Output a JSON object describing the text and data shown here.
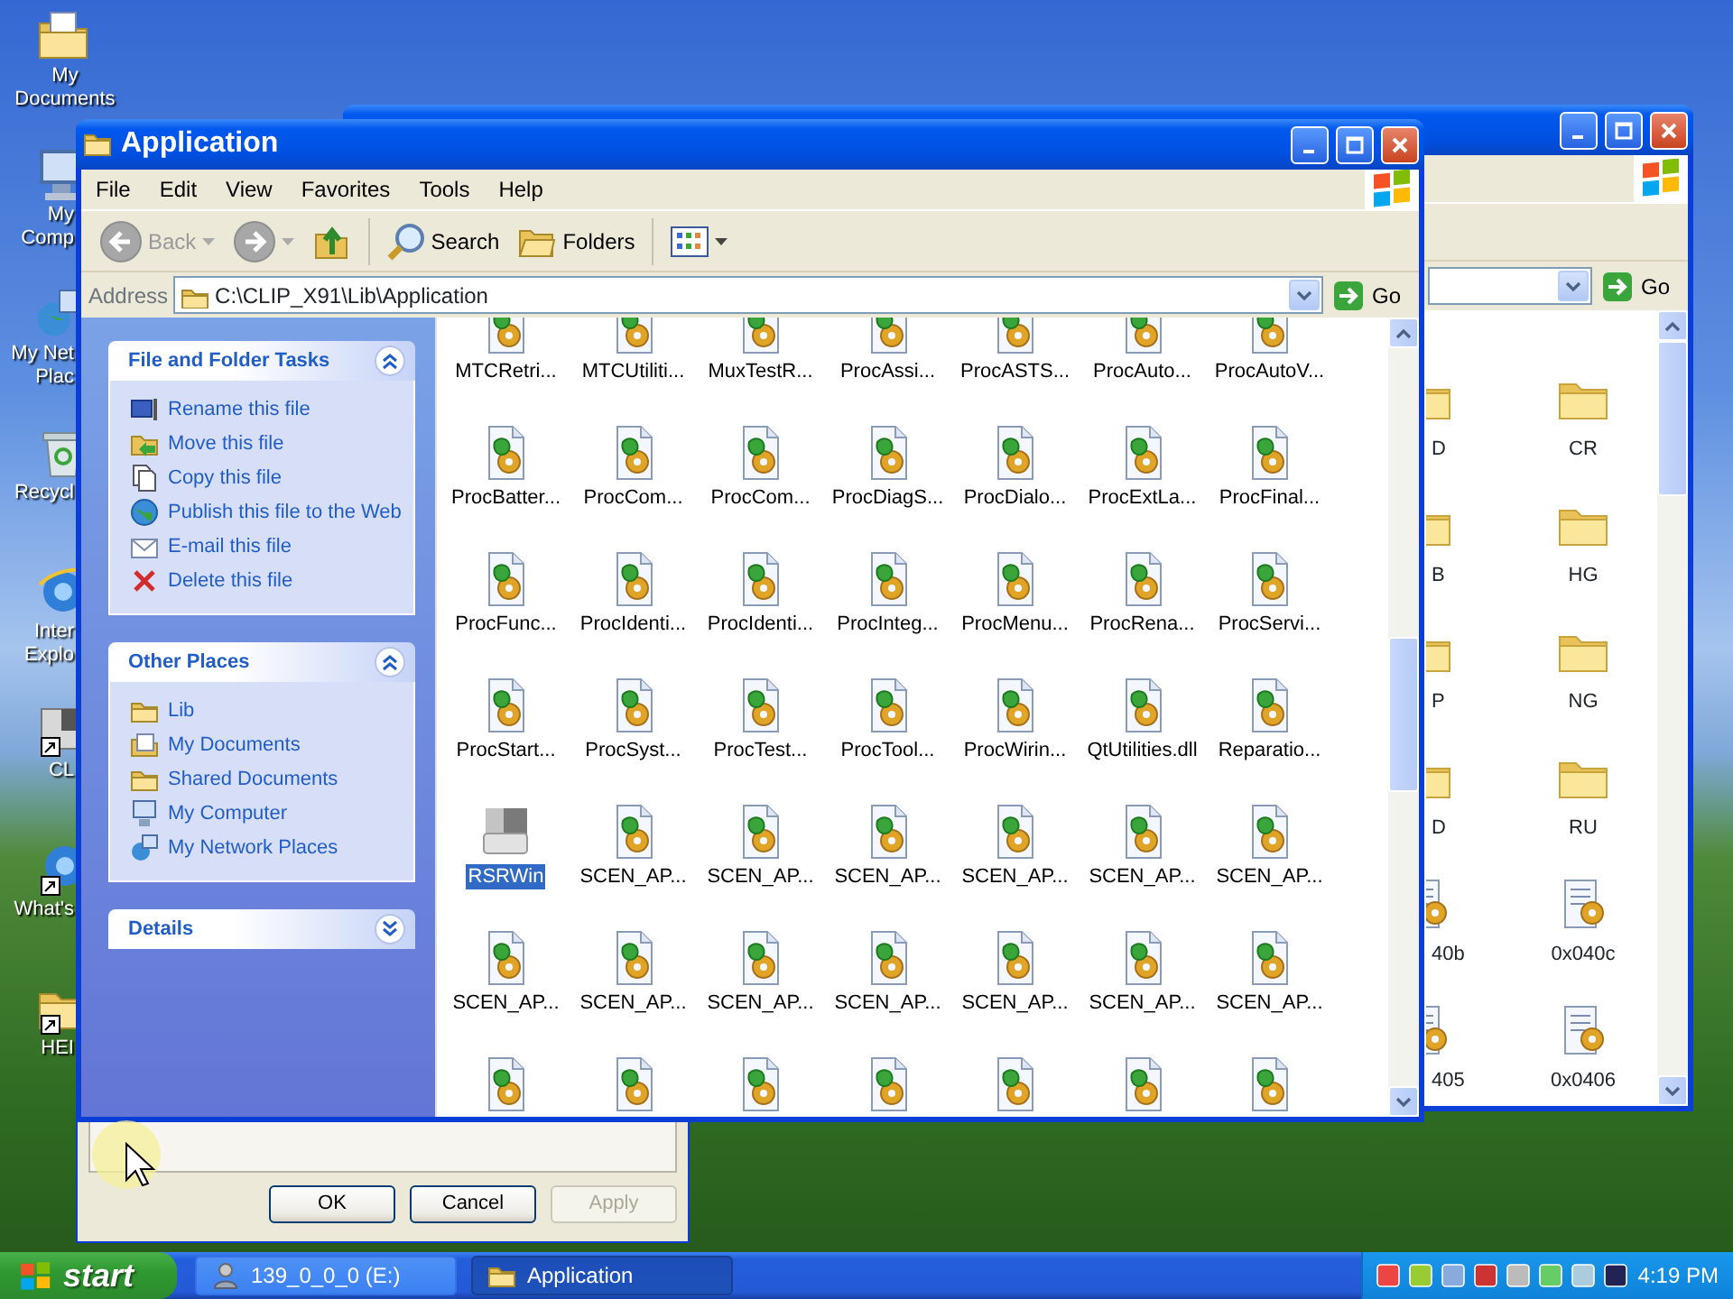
{
  "desktop": {
    "icons": [
      {
        "kind": "documents",
        "label": "My Documents"
      },
      {
        "kind": "computer",
        "label": "My Comp"
      },
      {
        "kind": "network",
        "label": "My Net Plac"
      },
      {
        "kind": "recycle",
        "label": "Recycl"
      },
      {
        "kind": "browser",
        "label": "Inter Explo"
      },
      {
        "kind": "app-shortcut",
        "label": "CL"
      },
      {
        "kind": "browser-shortcut",
        "label": "What's"
      },
      {
        "kind": "folder-shortcut",
        "label": "HEI"
      }
    ]
  },
  "back_window": {
    "go": "Go",
    "rows": [
      {
        "cells": [
          {
            "kind": "folder",
            "label": "D"
          },
          {
            "kind": "folder",
            "label": "CR"
          }
        ]
      },
      {
        "cells": [
          {
            "kind": "folder",
            "label": "B"
          },
          {
            "kind": "folder",
            "label": "HG"
          }
        ]
      },
      {
        "cells": [
          {
            "kind": "folder",
            "label": "P"
          },
          {
            "kind": "folder",
            "label": "NG"
          }
        ]
      },
      {
        "cells": [
          {
            "kind": "folder",
            "label": "D"
          },
          {
            "kind": "folder",
            "label": "RU"
          }
        ]
      },
      {
        "cells": [
          {
            "kind": "note",
            "label": "40b"
          },
          {
            "kind": "note",
            "label": "0x040c"
          }
        ]
      },
      {
        "cells": [
          {
            "kind": "note",
            "label": "405"
          },
          {
            "kind": "note",
            "label": "0x0406"
          }
        ]
      }
    ]
  },
  "dialog": {
    "buttons": [
      {
        "label": "OK",
        "disabled": false
      },
      {
        "label": "Cancel",
        "disabled": false
      },
      {
        "label": "Apply",
        "disabled": true
      }
    ]
  },
  "window": {
    "title": "Application",
    "menu": [
      "File",
      "Edit",
      "View",
      "Favorites",
      "Tools",
      "Help"
    ],
    "toolbar": [
      {
        "kind": "back",
        "label": "Back",
        "disabled": true
      },
      {
        "kind": "forward",
        "disabled": true
      },
      {
        "kind": "up",
        "disabled": false
      },
      {
        "kind": "search",
        "label": "Search"
      },
      {
        "kind": "folders",
        "label": "Folders"
      },
      {
        "kind": "views"
      }
    ],
    "address": {
      "label": "Address",
      "value": "C:\\CLIP_X91\\Lib\\Application",
      "go": "Go"
    },
    "task_panels": [
      {
        "title": "File and Folder Tasks",
        "expanded": true,
        "items": [
          {
            "kind": "rename",
            "label": "Rename this file"
          },
          {
            "kind": "move",
            "label": "Move this file"
          },
          {
            "kind": "copy",
            "label": "Copy this file"
          },
          {
            "kind": "publish",
            "label": "Publish this file to the Web"
          },
          {
            "kind": "email",
            "label": "E-mail this file"
          },
          {
            "kind": "delete",
            "label": "Delete this file"
          }
        ]
      },
      {
        "title": "Other Places",
        "expanded": true,
        "items": [
          {
            "kind": "folder",
            "label": "Lib"
          },
          {
            "kind": "documents",
            "label": "My Documents"
          },
          {
            "kind": "folder",
            "label": "Shared Documents"
          },
          {
            "kind": "computer",
            "label": "My Computer"
          },
          {
            "kind": "network",
            "label": "My Network Places"
          }
        ]
      },
      {
        "title": "Details",
        "expanded": false
      }
    ],
    "files": [
      {
        "kind": "script",
        "label": "MTCRetri...",
        "selected": false
      },
      {
        "kind": "script",
        "label": "MTCUtiliti...",
        "selected": false
      },
      {
        "kind": "script",
        "label": "MuxTestR...",
        "selected": false
      },
      {
        "kind": "script",
        "label": "ProcAssi...",
        "selected": false
      },
      {
        "kind": "script",
        "label": "ProcASTS...",
        "selected": false
      },
      {
        "kind": "script",
        "label": "ProcAuto...",
        "selected": false
      },
      {
        "kind": "script",
        "label": "ProcAutoV...",
        "selected": false
      },
      {
        "kind": "script",
        "label": "ProcBatter...",
        "selected": false
      },
      {
        "kind": "script",
        "label": "ProcCom...",
        "selected": false
      },
      {
        "kind": "script",
        "label": "ProcCom...",
        "selected": false
      },
      {
        "kind": "script",
        "label": "ProcDiagS...",
        "selected": false
      },
      {
        "kind": "script",
        "label": "ProcDialo...",
        "selected": false
      },
      {
        "kind": "script",
        "label": "ProcExtLa...",
        "selected": false
      },
      {
        "kind": "script",
        "label": "ProcFinal...",
        "selected": false
      },
      {
        "kind": "script",
        "label": "ProcFunc...",
        "selected": false
      },
      {
        "kind": "script",
        "label": "ProcIdenti...",
        "selected": false
      },
      {
        "kind": "script",
        "label": "ProcIdenti...",
        "selected": false
      },
      {
        "kind": "script",
        "label": "ProcInteg...",
        "selected": false
      },
      {
        "kind": "script",
        "label": "ProcMenu...",
        "selected": false
      },
      {
        "kind": "script",
        "label": "ProcRena...",
        "selected": false
      },
      {
        "kind": "script",
        "label": "ProcServi...",
        "selected": false
      },
      {
        "kind": "script",
        "label": "ProcStart...",
        "selected": false
      },
      {
        "kind": "script",
        "label": "ProcSyst...",
        "selected": false
      },
      {
        "kind": "script",
        "label": "ProcTest...",
        "selected": false
      },
      {
        "kind": "script",
        "label": "ProcTool...",
        "selected": false
      },
      {
        "kind": "script",
        "label": "ProcWirin...",
        "selected": false
      },
      {
        "kind": "script",
        "label": "QtUtilities.dll",
        "selected": false
      },
      {
        "kind": "script",
        "label": "Reparatio...",
        "selected": false
      },
      {
        "kind": "app",
        "label": "RSRWin",
        "selected": true
      },
      {
        "kind": "script",
        "label": "SCEN_AP...",
        "selected": false
      },
      {
        "kind": "script",
        "label": "SCEN_AP...",
        "selected": false
      },
      {
        "kind": "script",
        "label": "SCEN_AP...",
        "selected": false
      },
      {
        "kind": "script",
        "label": "SCEN_AP...",
        "selected": false
      },
      {
        "kind": "script",
        "label": "SCEN_AP...",
        "selected": false
      },
      {
        "kind": "script",
        "label": "SCEN_AP...",
        "selected": false
      },
      {
        "kind": "script",
        "label": "SCEN_AP...",
        "selected": false
      },
      {
        "kind": "script",
        "label": "SCEN_AP...",
        "selected": false
      },
      {
        "kind": "script",
        "label": "SCEN_AP...",
        "selected": false
      },
      {
        "kind": "script",
        "label": "SCEN_AP...",
        "selected": false
      },
      {
        "kind": "script",
        "label": "SCEN_AP...",
        "selected": false
      },
      {
        "kind": "script",
        "label": "SCEN_AP...",
        "selected": false
      },
      {
        "kind": "script",
        "label": "SCEN_AP...",
        "selected": false
      },
      {
        "kind": "script",
        "selected": false
      },
      {
        "kind": "script",
        "selected": false
      },
      {
        "kind": "script",
        "selected": false
      },
      {
        "kind": "script",
        "selected": false
      },
      {
        "kind": "script",
        "selected": false
      },
      {
        "kind": "script",
        "selected": false
      },
      {
        "kind": "script",
        "selected": false
      }
    ]
  },
  "taskbar": {
    "start": "start",
    "tasks": [
      {
        "kind": "drive",
        "label": "139_0_0_0 (E:)",
        "selected": false
      },
      {
        "kind": "folder",
        "label": "Application",
        "selected": true
      }
    ],
    "clock": "4:19 PM"
  }
}
